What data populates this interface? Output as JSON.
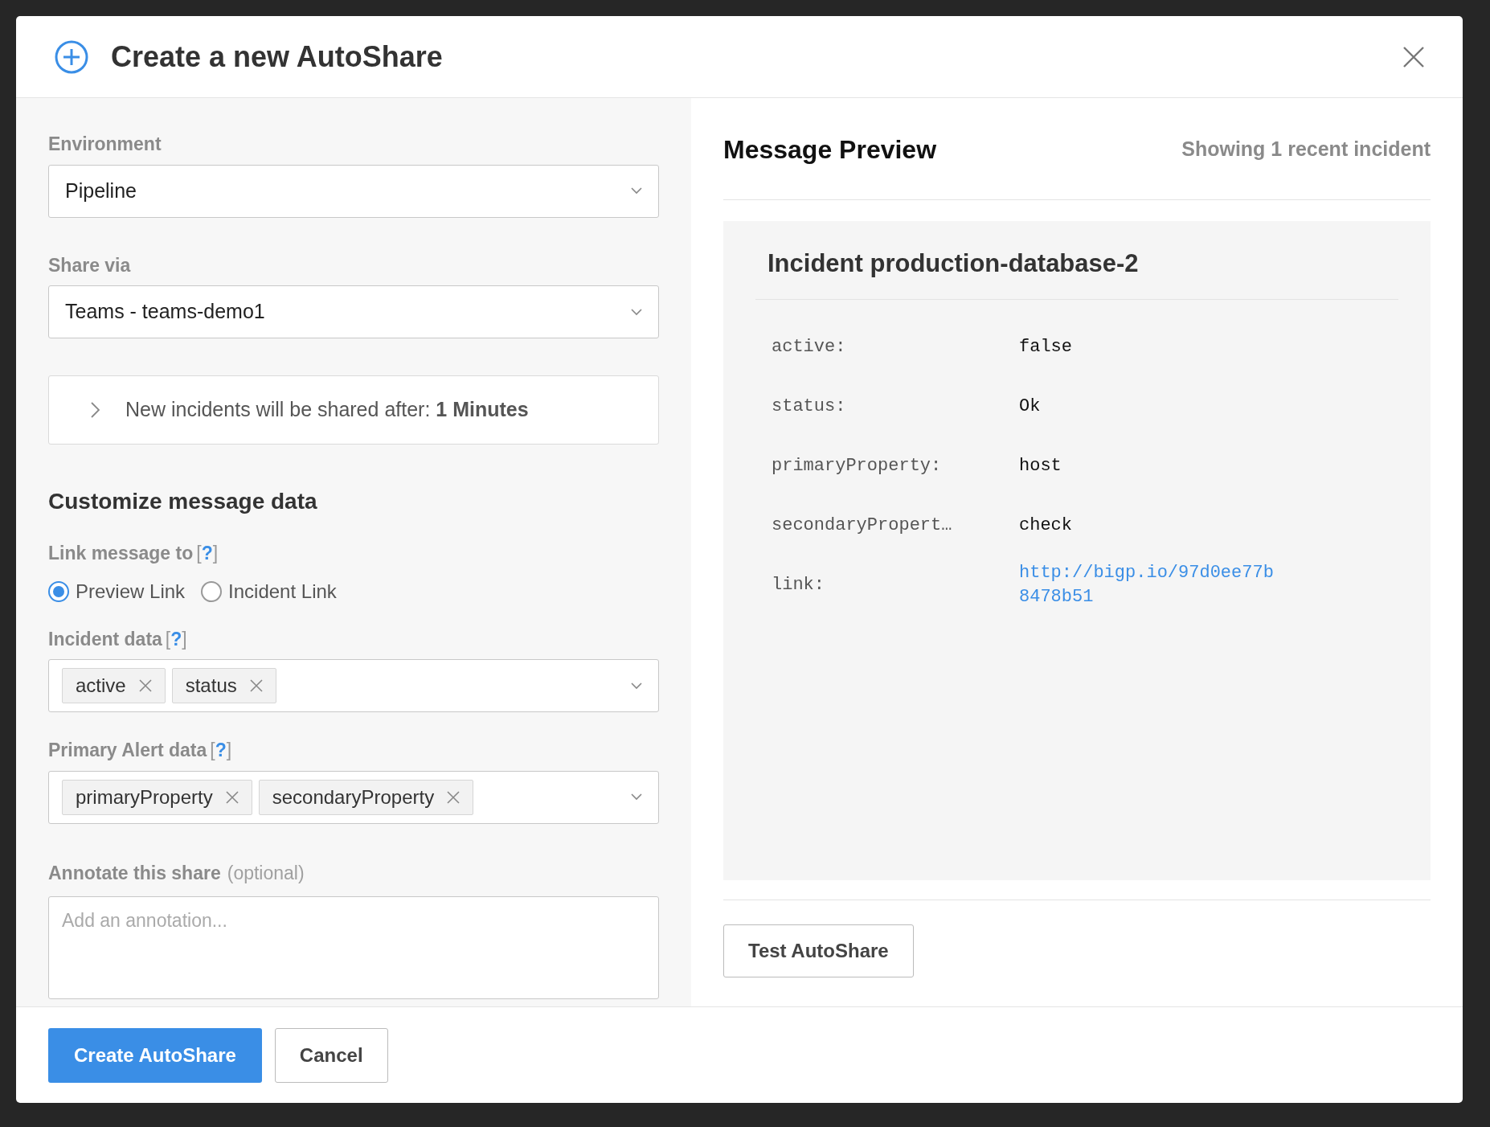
{
  "dialog": {
    "title": "Create a new AutoShare"
  },
  "environment": {
    "label": "Environment",
    "value": "Pipeline"
  },
  "share_via": {
    "label": "Share via",
    "value": "Teams - teams-demo1"
  },
  "delay": {
    "text": "New incidents will be shared after: **1 Minutes**",
    "expanded": false
  },
  "customize": {
    "heading": "Customize message data",
    "link_to": {
      "label": "Link message to",
      "help": "[**?**]",
      "options": [
        {
          "label": "Preview Link",
          "selected": true
        },
        {
          "label": "Incident Link",
          "selected": false
        }
      ]
    },
    "incident_data": {
      "label": "Incident data",
      "help": "[**?**]",
      "tags": [
        "active",
        "status"
      ]
    },
    "alert_data": {
      "label": "Primary Alert data",
      "help": "[**?**]",
      "tags": [
        "primaryProperty",
        "secondaryProperty"
      ]
    },
    "annotate": {
      "label": "Annotate this share",
      "hint": "(optional)",
      "placeholder": "Add an annotation..."
    }
  },
  "preview": {
    "title": "Message Preview",
    "count": "Showing 1 recent incident",
    "incident_title": "Incident production-database-2",
    "rows": [
      {
        "key": "active:",
        "value": "false",
        "kind": "text"
      },
      {
        "key": "status:",
        "value": "Ok",
        "kind": "text"
      },
      {
        "key": "primaryProperty:",
        "value": "host",
        "kind": "text"
      },
      {
        "key": "secondaryPropert…",
        "value": "check",
        "kind": "text"
      },
      {
        "key": "link:",
        "value": "http://bigp.io/97d0ee77b8478b51",
        "kind": "link"
      }
    ],
    "test_button": "Test AutoShare"
  },
  "footer": {
    "buttons": [
      {
        "label": "Create AutoShare",
        "kind": "primary"
      },
      {
        "label": "Cancel",
        "kind": "secondary"
      }
    ]
  }
}
